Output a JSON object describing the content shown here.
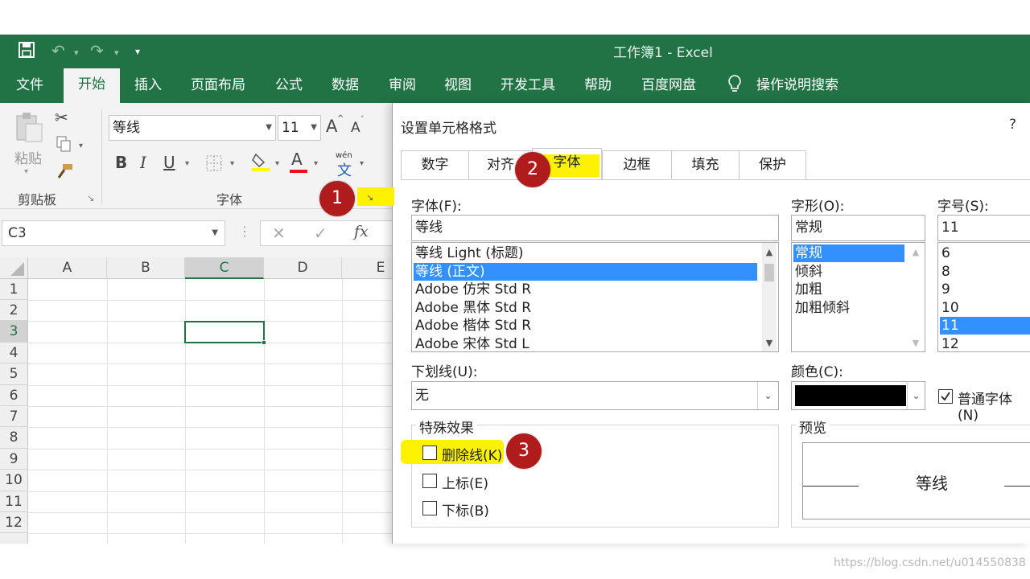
{
  "titlebar": {
    "title": "工作簿1  -  Excel"
  },
  "ribbon_tabs": [
    {
      "label": "文件",
      "active": false
    },
    {
      "label": "开始",
      "active": true
    },
    {
      "label": "插入",
      "active": false
    },
    {
      "label": "页面布局",
      "active": false
    },
    {
      "label": "公式",
      "active": false
    },
    {
      "label": "数据",
      "active": false
    },
    {
      "label": "审阅",
      "active": false
    },
    {
      "label": "视图",
      "active": false
    },
    {
      "label": "开发工具",
      "active": false
    },
    {
      "label": "帮助",
      "active": false
    },
    {
      "label": "百度网盘",
      "active": false
    },
    {
      "label": "操作说明搜索",
      "active": false
    }
  ],
  "ribbon": {
    "paste_label": "粘贴",
    "clipboard_group": "剪贴板",
    "font_group": "字体",
    "font_name": "等线",
    "font_size": "11",
    "bold": "B",
    "italic": "I",
    "underline": "U",
    "grow_font": "A",
    "shrink_font": "A",
    "font_color": "A",
    "phonetic_top": "wén",
    "phonetic_bottom": "文"
  },
  "formula_bar": {
    "name_box": "C3",
    "fx": "fx"
  },
  "grid": {
    "columns": [
      "A",
      "B",
      "C",
      "D",
      "E"
    ],
    "rows": [
      "1",
      "2",
      "3",
      "4",
      "5",
      "6",
      "7",
      "8",
      "9",
      "10",
      "11",
      "12"
    ],
    "selected_cell": "C3"
  },
  "dialog": {
    "title": "设置单元格格式",
    "help": "?",
    "tabs": [
      "数字",
      "对齐",
      "字体",
      "边框",
      "填充",
      "保护"
    ],
    "active_tab": "字体",
    "font_label": "字体(F):",
    "font_value": "等线",
    "font_list": [
      "等线 Light (标题)",
      "等线 (正文)",
      "Adobe 仿宋 Std R",
      "Adobe 黑体 Std R",
      "Adobe 楷体 Std R",
      "Adobe 宋体 Std L"
    ],
    "font_list_selected": 1,
    "style_label": "字形(O):",
    "style_value": "常规",
    "style_list": [
      "常规",
      "倾斜",
      "加粗",
      "加粗倾斜"
    ],
    "style_list_selected": 0,
    "size_label": "字号(S):",
    "size_value": "11",
    "size_list": [
      "6",
      "8",
      "9",
      "10",
      "11",
      "12"
    ],
    "size_list_selected": 4,
    "underline_label": "下划线(U):",
    "underline_value": "无",
    "color_label": "颜色(C):",
    "color_value": "#000000",
    "normal_font_label": "普通字体(N)",
    "normal_font_checked": true,
    "effects_label": "特殊效果",
    "strikethrough_label": "删除线(K)",
    "superscript_label": "上标(E)",
    "subscript_label": "下标(B)",
    "preview_label": "预览",
    "preview_text": "等线"
  },
  "callouts": [
    "1",
    "2",
    "3"
  ],
  "watermark": "https://blog.csdn.net/u014550838",
  "colors": {
    "excel_green": "#217346",
    "selection_blue": "#3390ff",
    "callout_red": "#b01c1c",
    "highlight_yellow": "#fff200"
  }
}
